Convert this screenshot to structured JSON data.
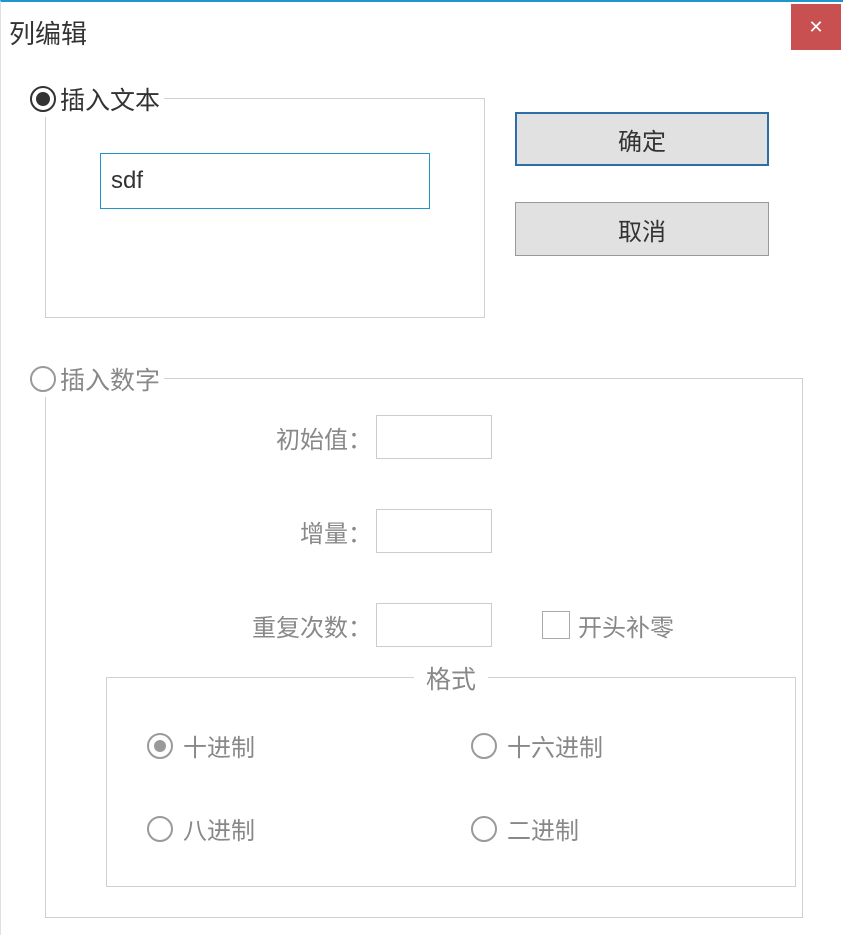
{
  "window": {
    "title": "列编辑"
  },
  "buttons": {
    "ok": "确定",
    "cancel": "取消"
  },
  "insertText": {
    "legend": "插入文本",
    "value": "sdf"
  },
  "insertNumber": {
    "legend": "插入数字",
    "initialLabel": "初始值：",
    "initialValue": "",
    "incrementLabel": "增量：",
    "incrementValue": "",
    "repeatLabel": "重复次数：",
    "repeatValue": "",
    "leadingZeroLabel": "开头补零"
  },
  "format": {
    "legend": "格式",
    "options": {
      "dec": "十进制",
      "hex": "十六进制",
      "oct": "八进制",
      "bin": "二进制"
    },
    "selected": "dec"
  }
}
